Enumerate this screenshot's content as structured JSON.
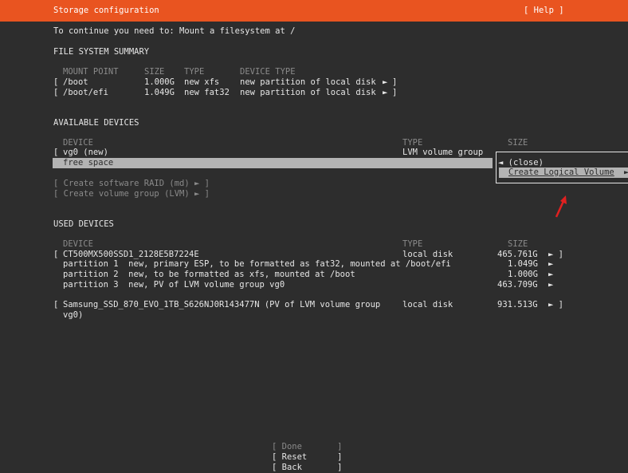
{
  "header": {
    "title": "Storage configuration",
    "help": "[ Help ]"
  },
  "instruction": "To continue you need to: Mount a filesystem at /",
  "fs_summary": {
    "heading": "FILE SYSTEM SUMMARY",
    "columns": [
      "MOUNT POINT",
      "SIZE",
      "TYPE",
      "DEVICE TYPE"
    ],
    "rows": [
      {
        "mount": "/boot",
        "size": "1.000G",
        "type": "new xfs",
        "device_type": "new partition of local disk",
        "arrow": "►",
        "open": "[",
        "close": "]"
      },
      {
        "mount": "/boot/efi",
        "size": "1.049G",
        "type": "new fat32",
        "device_type": "new partition of local disk",
        "arrow": "►",
        "open": "[",
        "close": "]"
      }
    ]
  },
  "available": {
    "heading": "AVAILABLE DEVICES",
    "columns": {
      "device": "DEVICE",
      "type": "TYPE",
      "size": "SIZE"
    },
    "vg": {
      "open": "[",
      "name": "vg0 (new)",
      "type": "LVM volume group"
    },
    "free_space": "free space",
    "actions": [
      {
        "label": "[ Create software RAID (md) ► ]"
      },
      {
        "label": "[ Create volume group (LVM) ► ]"
      }
    ]
  },
  "popup": {
    "close": "◄ (close)",
    "create_lv": "Create Logical Volume",
    "create_lv_arrow": "►"
  },
  "used": {
    "heading": "USED DEVICES",
    "columns": {
      "device": "DEVICE",
      "type": "TYPE",
      "size": "SIZE"
    },
    "disk1": {
      "open": "[",
      "name": "CT500MX500SSD1_2128E5B7224E",
      "type": "local disk",
      "size": "465.761G",
      "arrow": "► ]"
    },
    "partitions": [
      {
        "label": "partition 1  new, primary ESP, to be formatted as fat32, mounted at /boot/efi",
        "size": "1.049G",
        "arrow": "►"
      },
      {
        "label": "partition 2  new, to be formatted as xfs, mounted at /boot",
        "size": "1.000G",
        "arrow": "►"
      },
      {
        "label": "partition 3  new, PV of LVM volume group vg0",
        "size": "463.709G",
        "arrow": "►"
      }
    ],
    "disk2": {
      "open": "[",
      "name_line1": "Samsung_SSD_870_EVO_1TB_S626NJ0R143477N (PV of LVM volume group",
      "name_line2": "vg0)",
      "type": "local disk",
      "size": "931.513G",
      "arrow": "► ]"
    }
  },
  "buttons": {
    "done": "[ Done       ]",
    "reset": "[ Reset      ]",
    "back": "[ Back       ]"
  },
  "colors": {
    "header": "#e95420",
    "background": "#2d2d2d",
    "selection": "#b3b3b3",
    "annotation_arrow": "#e02020"
  }
}
